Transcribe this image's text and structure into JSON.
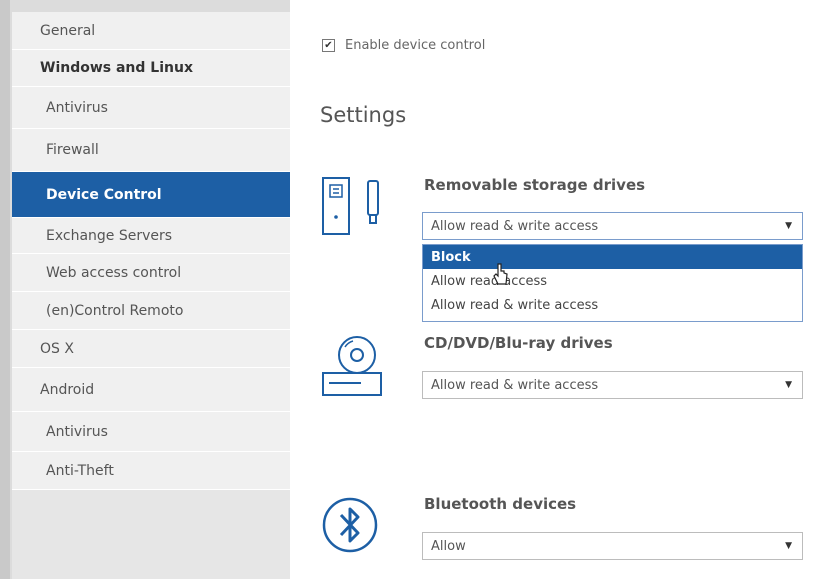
{
  "sidebar": {
    "items": [
      {
        "label": "General"
      },
      {
        "label": "Windows and Linux"
      },
      {
        "label": "Antivirus"
      },
      {
        "label": "Firewall"
      },
      {
        "label": "Device Control"
      },
      {
        "label": "Exchange Servers"
      },
      {
        "label": "Web access control"
      },
      {
        "label": "(en)Control Remoto"
      },
      {
        "label": "OS X"
      },
      {
        "label": "Android"
      },
      {
        "label": "Antivirus"
      },
      {
        "label": "Anti-Theft"
      }
    ]
  },
  "main": {
    "enable_label": "Enable device control",
    "settings_title": "Settings",
    "removable": {
      "label": "Removable storage drives",
      "value": "Allow read & write access",
      "options": [
        "Block",
        "Allow read access",
        "Allow read & write access"
      ]
    },
    "cd": {
      "label": "CD/DVD/Blu-ray drives",
      "value": "Allow read & write access"
    },
    "bluetooth": {
      "label": "Bluetooth devices",
      "value": "Allow"
    }
  },
  "icons": {
    "arrow": "▼",
    "check": "✔"
  },
  "colors": {
    "accent": "#1d5fa5"
  }
}
